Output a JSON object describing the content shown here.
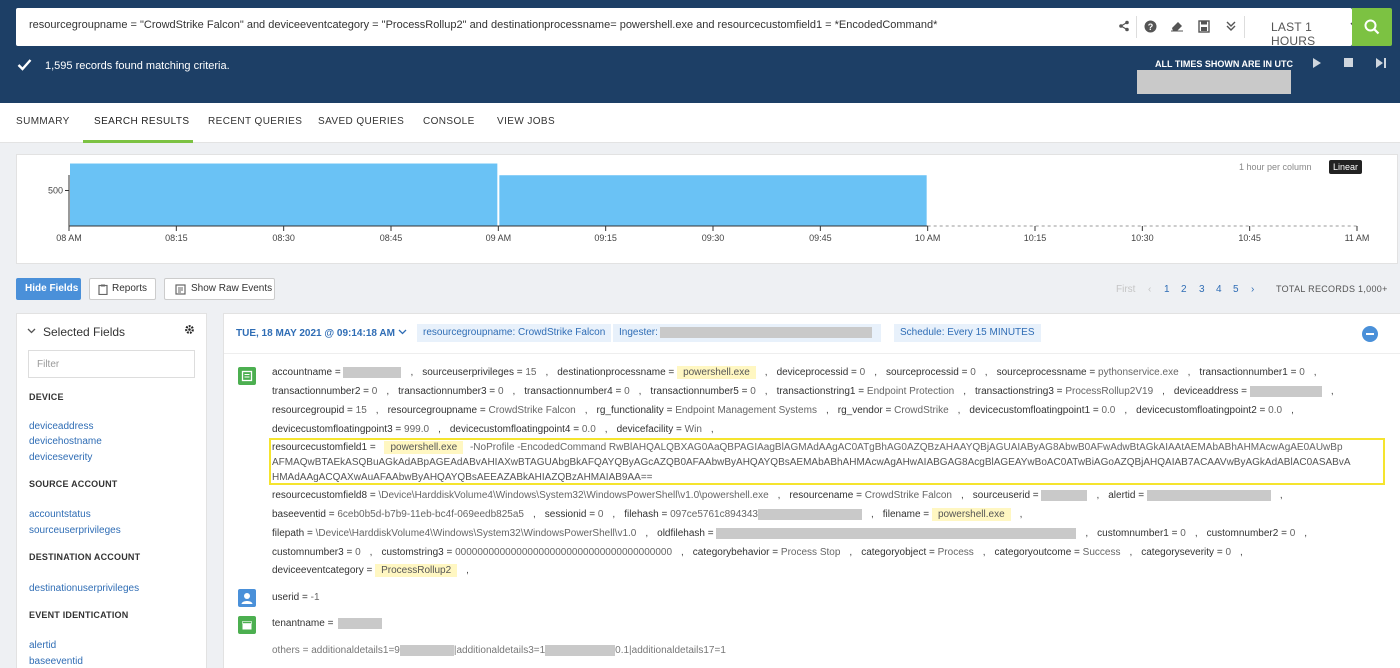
{
  "query": {
    "text": "resourcegroupname = \"CrowdStrike Falcon\" and deviceeventcategory = \"ProcessRollup2\"  and destinationprocessname= powershell.exe and resourcecustomfield1 = *EncodedCommand*",
    "time_range": "LAST 1 HOURS"
  },
  "status": {
    "records_found": "1,595 records found matching criteria.",
    "times_note": "ALL TIMES SHOWN ARE IN UTC"
  },
  "tabs": [
    "SUMMARY",
    "SEARCH RESULTS",
    "RECENT QUERIES",
    "SAVED QUERIES",
    "CONSOLE",
    "VIEW JOBS"
  ],
  "chart_data": {
    "type": "bar",
    "x_ticks": [
      "08 AM",
      "08:15",
      "08:30",
      "08:45",
      "09 AM",
      "09:15",
      "09:30",
      "09:45",
      "10 AM",
      "10:15",
      "10:30",
      "10:45",
      "11 AM"
    ],
    "y_ticks": [
      500
    ],
    "bars": [
      {
        "start": "08:00",
        "end": "09:00",
        "value": 880
      },
      {
        "start": "09:00",
        "end": "10:00",
        "value": 715
      }
    ],
    "ylim": [
      0,
      1000
    ],
    "note": "1 hour per column",
    "scale": "Linear"
  },
  "actions": {
    "hide_fields": "Hide Fields",
    "reports": "Reports",
    "show_raw": "Show Raw Events"
  },
  "pager": {
    "first": "First",
    "prev": "‹",
    "pages": [
      "1",
      "2",
      "3",
      "4",
      "5"
    ],
    "next": "›",
    "total": "TOTAL RECORDS  1,000+"
  },
  "sidebar": {
    "title": "Selected Fields",
    "filter_placeholder": "Filter",
    "sections": [
      {
        "head": "DEVICE",
        "items": [
          "deviceaddress",
          "devicehostname",
          "deviceseverity"
        ]
      },
      {
        "head": "SOURCE ACCOUNT",
        "items": [
          "accountstatus",
          "sourceuserprivileges"
        ]
      },
      {
        "head": "DESTINATION ACCOUNT",
        "items": [
          "destinationuserprivileges"
        ]
      },
      {
        "head": "EVENT IDENTICATION",
        "items": [
          "alertid",
          "baseeventid"
        ]
      }
    ]
  },
  "event": {
    "date": "TUE, 18 MAY 2021 @ 09:14:18 AM",
    "tags": [
      "resourcegroupname: CrowdStrike Falcon",
      "Ingester:",
      "Schedule: Every 15 MINUTES"
    ],
    "line1": [
      {
        "k": "accountname =",
        "v": ""
      },
      {
        "k": "sourceuserprivileges =",
        "v": "15"
      },
      {
        "k": "destinationprocessname =",
        "hl": "powershell.exe"
      },
      {
        "k": "deviceprocessid =",
        "v": "0"
      },
      {
        "k": "sourceprocessid =",
        "v": "0"
      },
      {
        "k": "sourceprocessname =",
        "v": "pythonservice.exe"
      },
      {
        "k": "transactionnumber1 =",
        "v": "0"
      }
    ],
    "line2": [
      {
        "k": "transactionnumber2 =",
        "v": "0"
      },
      {
        "k": "transactionnumber3 =",
        "v": "0"
      },
      {
        "k": "transactionnumber4 =",
        "v": "0"
      },
      {
        "k": "transactionnumber5 =",
        "v": "0"
      },
      {
        "k": "transactionstring1 =",
        "v": "Endpoint Protection"
      },
      {
        "k": "transactionstring3 =",
        "v": "ProcessRollup2V19"
      },
      {
        "k": "deviceaddress =",
        "v": ""
      }
    ],
    "line3": [
      {
        "k": "resourcegroupid =",
        "v": "15"
      },
      {
        "k": "resourcegroupname =",
        "v": "CrowdStrike Falcon"
      },
      {
        "k": "rg_functionality =",
        "v": "Endpoint Management Systems"
      },
      {
        "k": "rg_vendor =",
        "v": "CrowdStrike"
      },
      {
        "k": "devicecustomfloatingpoint1 =",
        "v": "0.0"
      },
      {
        "k": "devicecustomfloatingpoint2 =",
        "v": "0.0"
      }
    ],
    "line4": [
      {
        "k": "devicecustomfloatingpoint3 =",
        "v": "999.0"
      },
      {
        "k": "devicecustomfloatingpoint4 =",
        "v": "0.0"
      },
      {
        "k": "devicefacility =",
        "v": "Win"
      }
    ],
    "rcf1_key": "resourcecustomfield1 =",
    "rcf1_hl": "powershell.exe",
    "rcf1_text1": "-NoProfile -EncodedCommand RwBlAHQALQBXAG0AaQBPAGIAagBlAGMAdAAgAC0ATgBhAG0AZQBzAHAAYQBjAGUAIAByAG8AbwB0AFwAdwBtAGkAIAAtAEMAbABhAHMAcwAgAE0AUwBp",
    "rcf1_text2": "AFMAQwBTAEkASQBuAGkAdABpAGEAdABvAHIAXwBTAGUAbgBkAFQAYQByAGcAZQB0AFAAbwByAHQAYQBsAEMAbABhAHMAcwAgAHwAIABGAG8AcgBlAGEAYwBoAC0ATwBiAGoAZQBjAHQAIAB7ACAAVwByAGkAdABlAC0ASABvA",
    "rcf1_text3": "HMAdAAgACQAXwAuAFAAbwByAHQAYQBsAEEAZABkAHIAZQBzAHMAIAB9AA==",
    "line5": [
      {
        "k": "resourcecustomfield8 =",
        "v": "\\Device\\HarddiskVolume4\\Windows\\System32\\WindowsPowerShell\\v1.0\\powershell.exe"
      },
      {
        "k": "resourcename =",
        "v": "CrowdStrike Falcon"
      },
      {
        "k": "sourceuserid =",
        "v": ""
      },
      {
        "k": "alertid =",
        "v": ""
      }
    ],
    "line6": [
      {
        "k": "baseeventid =",
        "v": "6ceb0b5d-b7b9-11eb-bc4f-069eedb825a5"
      },
      {
        "k": "sessionid =",
        "v": "0"
      },
      {
        "k": "filehash =",
        "v": "097ce5761c894343"
      },
      {
        "k": "filename =",
        "hl": "powershell.exe"
      }
    ],
    "line7": [
      {
        "k": "filepath =",
        "v": "\\Device\\HarddiskVolume4\\Windows\\System32\\WindowsPowerShell\\v1.0"
      },
      {
        "k": "oldfilehash =",
        "v": ""
      },
      {
        "k": "customnumber1 =",
        "v": "0"
      },
      {
        "k": "customnumber2 =",
        "v": "0"
      }
    ],
    "line8": [
      {
        "k": "customnumber3 =",
        "v": "0"
      },
      {
        "k": "customstring3 =",
        "v": "000000000000000000000000000000000000000"
      },
      {
        "k": "categorybehavior =",
        "v": "Process Stop"
      },
      {
        "k": "categoryobject =",
        "v": "Process"
      },
      {
        "k": "categoryoutcome =",
        "v": "Success"
      },
      {
        "k": "categoryseverity =",
        "v": "0"
      }
    ],
    "line9": [
      {
        "k": "deviceeventcategory =",
        "hl": "ProcessRollup2"
      }
    ],
    "userid_key": "userid =",
    "userid_val": "-1",
    "tenant_key": "tenantname =",
    "others_text1": "others = additionaldetails1=9",
    "others_text2": "|additionaldetails3=1",
    "others_text3": "0.1|additionaldetails17=1"
  }
}
